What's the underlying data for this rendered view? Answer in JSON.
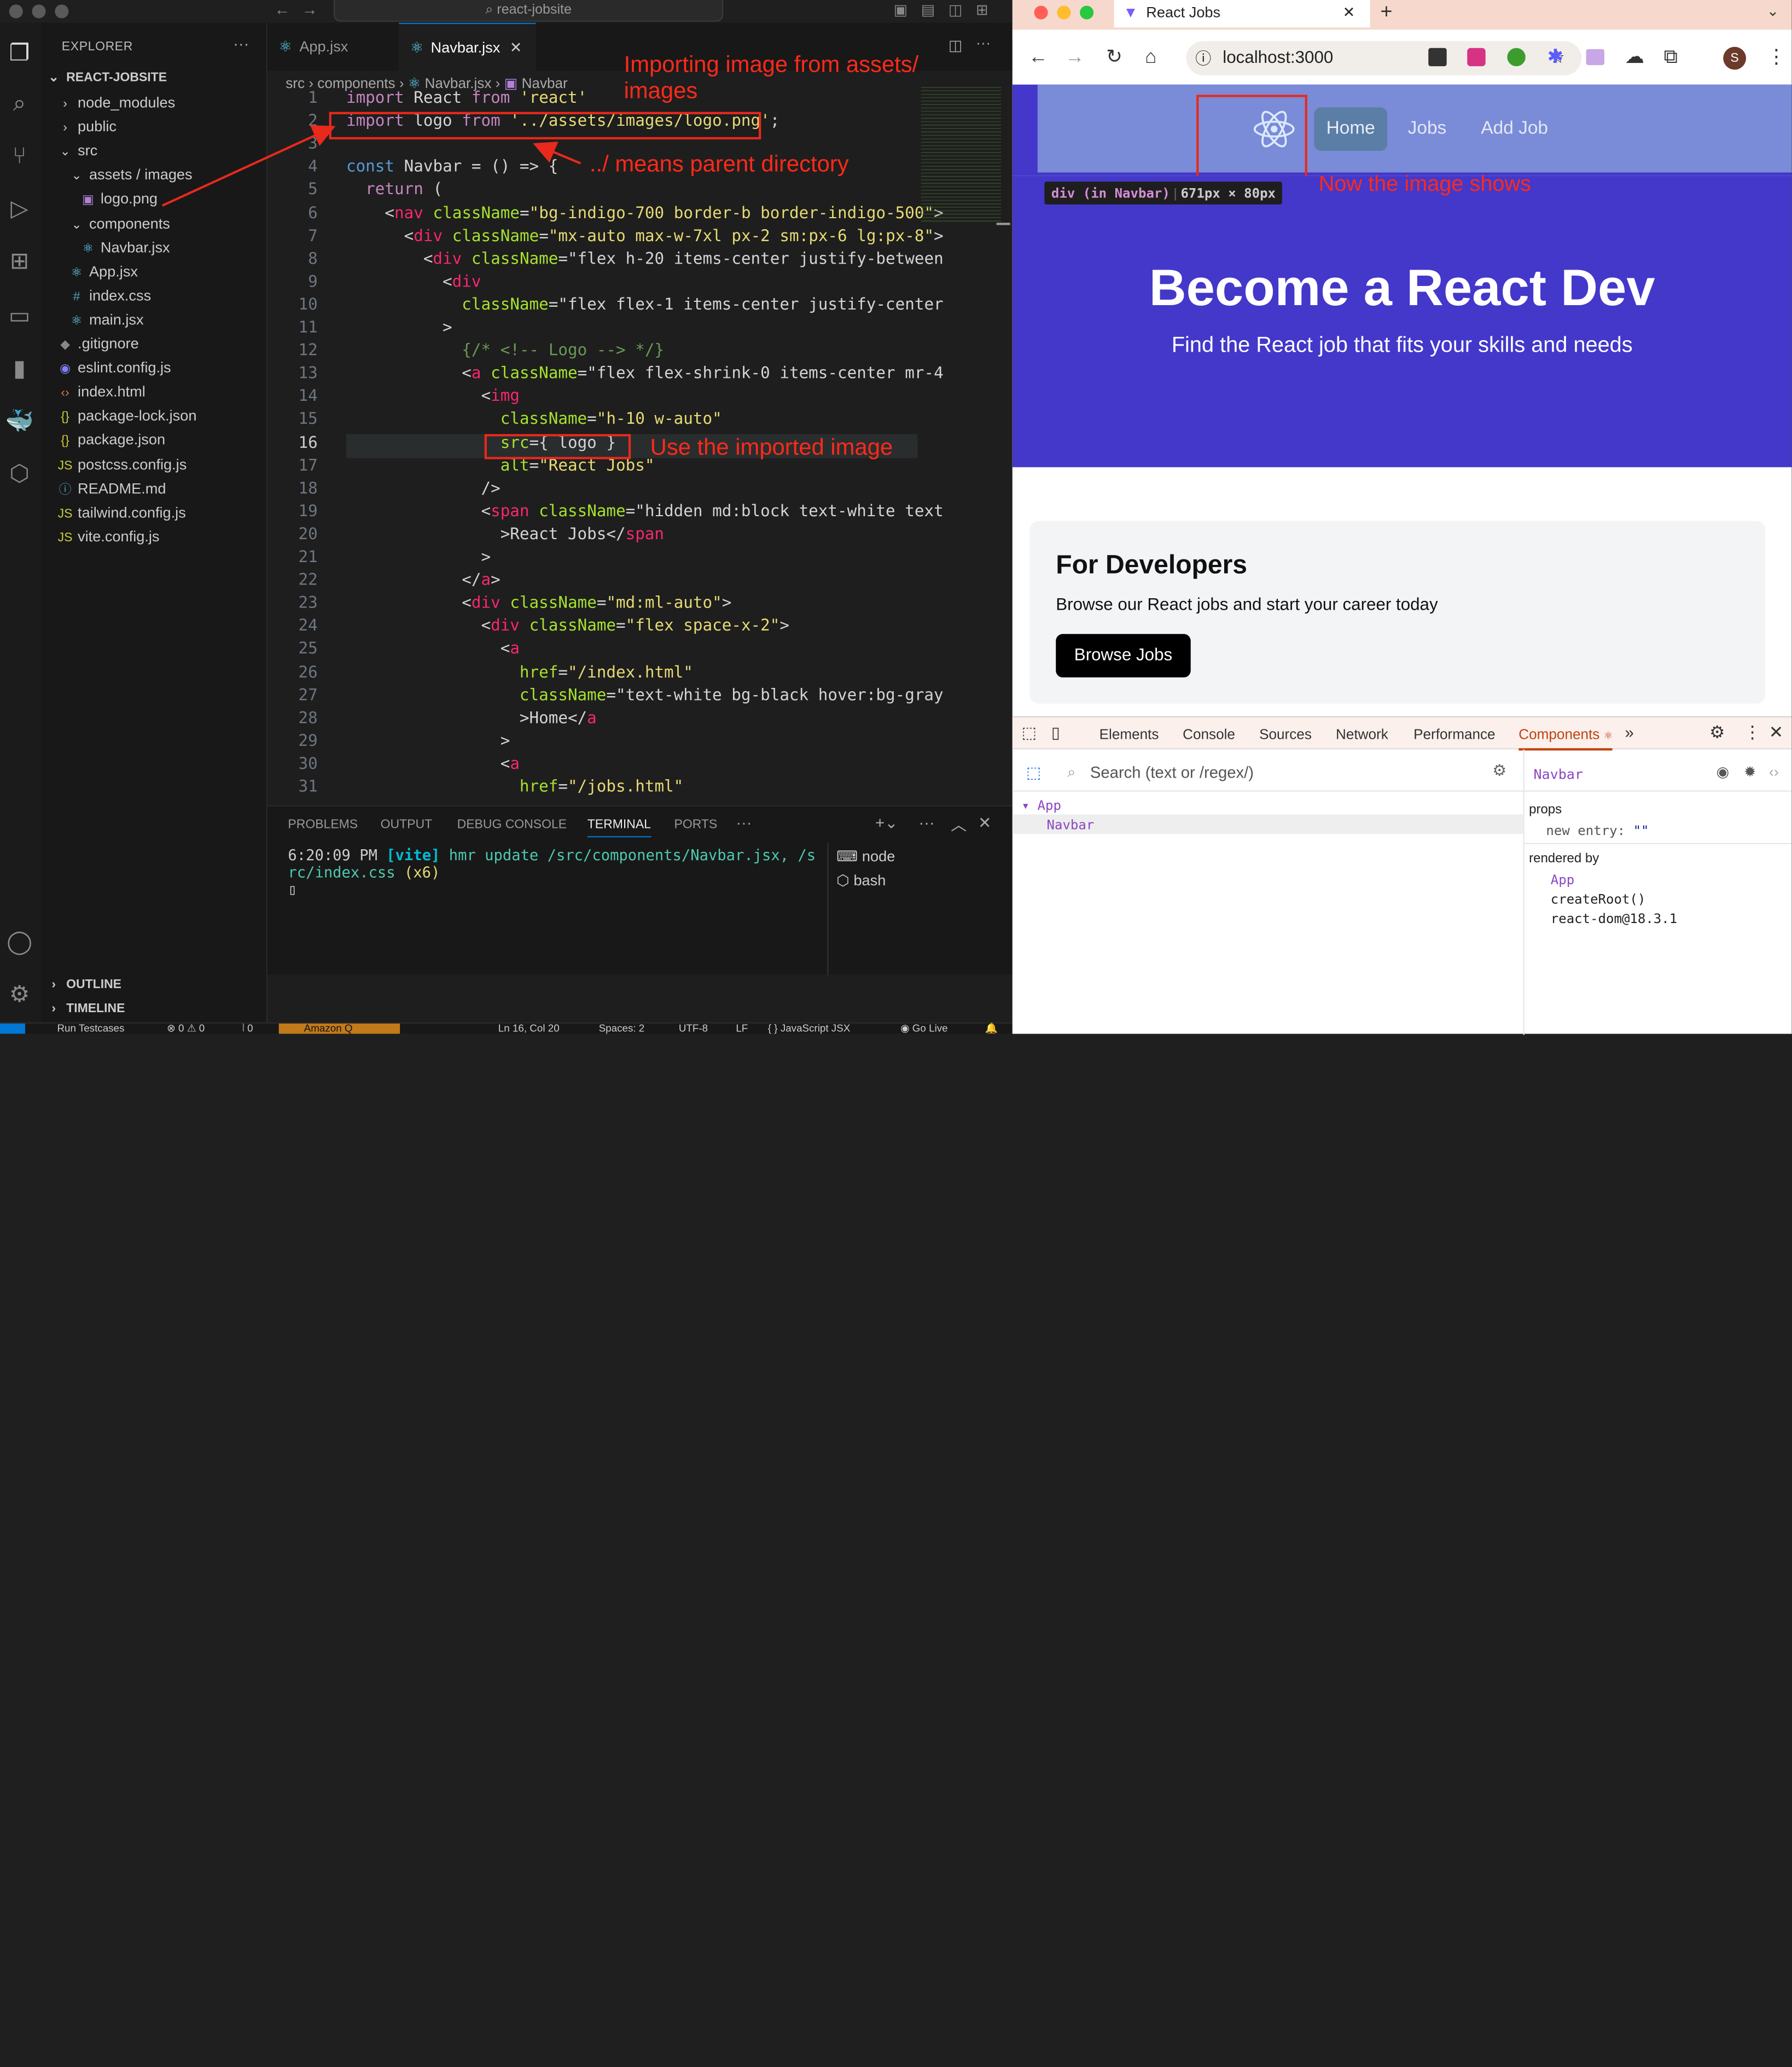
{
  "vscode": {
    "window_title": "react-jobsite",
    "explorer": {
      "header": "EXPLORER",
      "project": "REACT-JOBSITE",
      "items": [
        {
          "label": "node_modules",
          "icon": "chevron-right",
          "depth": 1
        },
        {
          "label": "public",
          "icon": "chevron-right",
          "depth": 1
        },
        {
          "label": "src",
          "icon": "chevron-down",
          "depth": 1
        },
        {
          "label": "assets / images",
          "icon": "chevron-down",
          "depth": 2
        },
        {
          "label": "logo.png",
          "icon": "image",
          "depth": 3
        },
        {
          "label": "components",
          "icon": "chevron-down",
          "depth": 2
        },
        {
          "label": "Navbar.jsx",
          "icon": "react",
          "depth": 3
        },
        {
          "label": "App.jsx",
          "icon": "react",
          "depth": 2
        },
        {
          "label": "index.css",
          "icon": "hash",
          "depth": 2
        },
        {
          "label": "main.jsx",
          "icon": "react",
          "depth": 2
        },
        {
          "label": ".gitignore",
          "icon": "git",
          "depth": 1
        },
        {
          "label": "eslint.config.js",
          "icon": "eslint",
          "depth": 1
        },
        {
          "label": "index.html",
          "icon": "html",
          "depth": 1
        },
        {
          "label": "package-lock.json",
          "icon": "json",
          "depth": 1
        },
        {
          "label": "package.json",
          "icon": "json",
          "depth": 1
        },
        {
          "label": "postcss.config.js",
          "icon": "js",
          "depth": 1
        },
        {
          "label": "README.md",
          "icon": "info",
          "depth": 1
        },
        {
          "label": "tailwind.config.js",
          "icon": "js",
          "depth": 1
        },
        {
          "label": "vite.config.js",
          "icon": "js",
          "depth": 1
        }
      ],
      "outline": "OUTLINE",
      "timeline": "TIMELINE"
    },
    "tabs": [
      {
        "label": "App.jsx",
        "active": false
      },
      {
        "label": "Navbar.jsx",
        "active": true
      }
    ],
    "breadcrumb": [
      "src",
      "components",
      "Navbar.jsx",
      "Navbar"
    ],
    "code_lines": [
      "import React from 'react'",
      "import logo from '../assets/images/logo.png';",
      "",
      "const Navbar = () => {",
      "  return (",
      "    <nav className=\"bg-indigo-700 border-b border-indigo-500\">",
      "      <div className=\"mx-auto max-w-7xl px-2 sm:px-6 lg:px-8\">",
      "        <div className=\"flex h-20 items-center justify-between",
      "          <div",
      "            className=\"flex flex-1 items-center justify-center",
      "          >",
      "            {/* <!-- Logo --> */}",
      "            <a className=\"flex flex-shrink-0 items-center mr-4",
      "              <img",
      "                className=\"h-10 w-auto\"",
      "                src={ logo }",
      "                alt=\"React Jobs\"",
      "              />",
      "              <span className=\"hidden md:block text-white text",
      "                >React Jobs</span",
      "              >",
      "            </a>",
      "            <div className=\"md:ml-auto\">",
      "              <div className=\"flex space-x-2\">",
      "                <a",
      "                  href=\"/index.html\"",
      "                  className=\"text-white bg-black hover:bg-gray",
      "                  >Home</a",
      "                >",
      "                <a",
      "                  href=\"/jobs.html\""
    ],
    "annotations": {
      "import": "Importing image from assets/ images",
      "parent": "../ means parent directory",
      "use": "Use the imported image"
    },
    "panel": {
      "tabs": [
        "PROBLEMS",
        "OUTPUT",
        "DEBUG CONSOLE",
        "TERMINAL",
        "PORTS"
      ],
      "active_tab": "TERMINAL",
      "terminal_time": "6:20:09 PM",
      "terminal_tag": "[vite]",
      "terminal_msg": "hmr update /src/components/Navbar.jsx, /s",
      "terminal_msg2": "rc/index.css",
      "terminal_count": "(x6)",
      "shells": [
        "node",
        "bash"
      ]
    },
    "status": {
      "run": "Run Testcases",
      "errors": "0 ⚠ 0",
      "ports": "0",
      "amazon": "Amazon Q",
      "position": "Ln 16, Col 20",
      "spaces": "Spaces: 2",
      "encoding": "UTF-8",
      "eol": "LF",
      "language": "{ } JavaScript JSX",
      "golive": "Go Live"
    }
  },
  "browser": {
    "tab_title": "React Jobs",
    "url": "localhost:3000",
    "profile_initial": "S",
    "nav_links": [
      "Home",
      "Jobs",
      "Add Job"
    ],
    "tooltip_tag": "div (in Navbar)",
    "tooltip_size": "671px × 80px",
    "annotation": "Now the image shows",
    "hero_title": "Become a React Dev",
    "hero_subtitle": "Find the React job that fits your skills and needs",
    "card_title": "For Developers",
    "card_text": "Browse our React jobs and start your career today",
    "card_button": "Browse Jobs",
    "devtools": {
      "tabs": [
        "Elements",
        "Console",
        "Sources",
        "Network",
        "Performance",
        "Components"
      ],
      "active_tab": "Components",
      "search_placeholder": "Search (text or /regex/)",
      "tree": [
        "App",
        "Navbar"
      ],
      "selected_component": "Navbar",
      "props_label": "props",
      "prop_key": "new entry:",
      "prop_val": "\"\"",
      "rendered_by_label": "rendered by",
      "rendered_by": [
        "App",
        "createRoot()",
        "react-dom@18.3.1"
      ]
    }
  },
  "colors": {
    "indigo": "#4338ca",
    "annotation_red": "#e8291c",
    "devtools_active": "#c2410c"
  }
}
